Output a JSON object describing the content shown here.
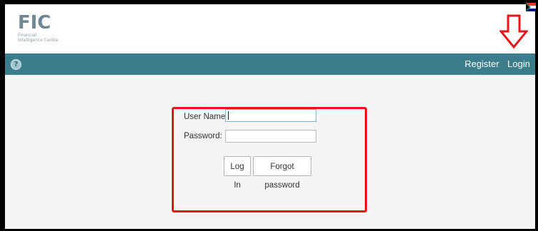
{
  "brand": {
    "logo_letters": "FIC",
    "logo_text_line1": "Financial",
    "logo_text_line2": "Intelligence Centre"
  },
  "nav": {
    "help_icon": "?",
    "register_label": "Register",
    "login_label": "Login"
  },
  "login_form": {
    "username_label": "User Name:",
    "username_value": "",
    "password_label": "Password:",
    "password_value": "",
    "login_button": "Log In",
    "forgot_button": "Forgot password"
  },
  "annotations": {
    "highlight_color": "#e3171b",
    "arrow_icon": "down-arrow-icon"
  },
  "colors": {
    "nav_bar": "#3b7d8c",
    "content_bg": "#f5f5f5"
  }
}
